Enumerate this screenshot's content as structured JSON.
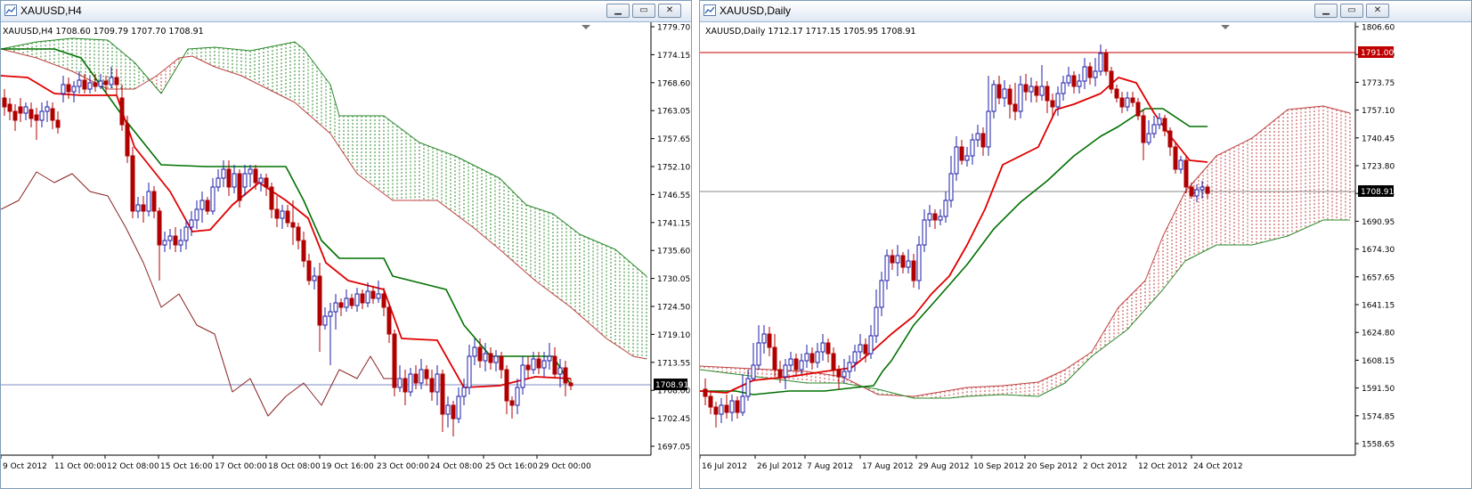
{
  "left": {
    "title": "XAUUSD,H4",
    "info": "XAUUSD,H4  1708.60 1709.79 1707.70 1708.91",
    "price_label": "1708.91",
    "y_ticks": [
      "1779.70",
      "1774.15",
      "1768.60",
      "1763.05",
      "1757.65",
      "1752.10",
      "1746.55",
      "1741.15",
      "1735.60",
      "1730.05",
      "1724.50",
      "1719.10",
      "1713.55",
      "1708.00",
      "1702.45",
      "1697.05"
    ],
    "x_ticks": [
      "9 Oct 2012",
      "11 Oct 00:00",
      "12 Oct 08:00",
      "15 Oct 16:00",
      "17 Oct 00:00",
      "18 Oct 08:00",
      "19 Oct 16:00",
      "23 Oct 00:00",
      "24 Oct 08:00",
      "25 Oct 16:00",
      "29 Oct 00:00"
    ]
  },
  "right": {
    "title": "XAUUSD,Daily",
    "info": "XAUUSD,Daily  1712.17 1717.15 1705.95 1708.91",
    "price_label": "1708.91",
    "hline_label": "1791.00",
    "y_ticks": [
      "1806.60",
      "1790.00",
      "1773.75",
      "1757.10",
      "1740.45",
      "1723.80",
      "1707.15",
      "1690.95",
      "1674.30",
      "1657.65",
      "1641.15",
      "1624.80",
      "1608.15",
      "1591.50",
      "1574.85",
      "1558.65"
    ],
    "x_ticks": [
      "16 Jul 2012",
      "26 Jul 2012",
      "7 Aug 2012",
      "17 Aug 2012",
      "29 Aug 2012",
      "10 Sep 2012",
      "20 Sep 2012",
      "2 Oct 2012",
      "12 Oct 2012",
      "24 Oct 2012"
    ]
  },
  "buttons": {
    "minimize": "▁",
    "restore": "▭",
    "close": "✕"
  },
  "colors": {
    "bull": "#1c1ca8",
    "bear": "#b00000",
    "tenkan": "#e00000",
    "kijun": "#007000",
    "chikou": "#8b2020",
    "kumo_bear": "#c04040",
    "kumo_bull": "#2a8a2a"
  }
}
